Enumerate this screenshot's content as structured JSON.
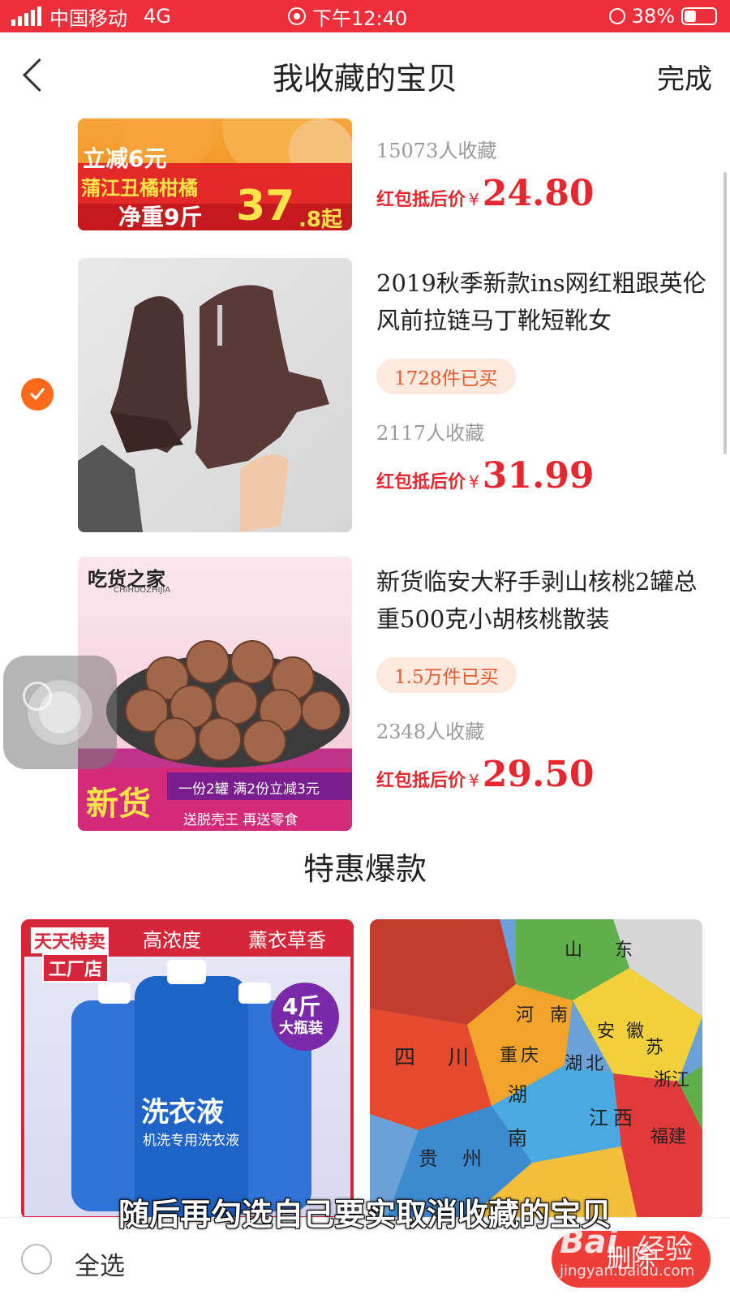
{
  "status_bar": {
    "carrier": "中国移动",
    "network": "4G",
    "time": "下午12:40",
    "battery": "38%",
    "battery_level": 0.38
  },
  "header": {
    "title": "我收藏的宝贝",
    "done": "完成"
  },
  "items": [
    {
      "favorites": "15073人收藏",
      "price_label": "红包抵后价",
      "currency": "¥",
      "price": "24.80",
      "image_text": {
        "line1": "立减6元",
        "line2": "蒲江丑橘柑橘",
        "line3": "净重9斤",
        "big": "37",
        "small": ".8起"
      }
    },
    {
      "name": "2019秋季新款ins网红粗跟英伦风前拉链马丁靴短靴女",
      "sold": "1728件已买",
      "favorites": "2117人收藏",
      "price_label": "红包抵后价",
      "currency": "¥",
      "price": "31.99",
      "checked": true
    },
    {
      "name": "新货临安大籽手剥山核桃2罐总重500克小胡核桃散装",
      "sold": "1.5万件已买",
      "favorites": "2348人收藏",
      "price_label": "红包抵后价",
      "currency": "¥",
      "price": "29.50",
      "image_text": {
        "brand": "吃货之家",
        "brand_en": "CHIHUOZHIJIA",
        "tag": "新货",
        "promo": "一份2罐  满2份立减3元",
        "promo2": "送脱壳王  再送零食"
      }
    }
  ],
  "section_title": "特惠爆款",
  "recommend": [
    {
      "badge_top": "天天特卖",
      "badge_bottom": "工厂店",
      "feat1": "高浓度",
      "feat2": "薰衣草香",
      "bubble1": "4斤",
      "bubble2": "大瓶装",
      "product": "洗衣液",
      "product_sub": "机洗专用洗衣液"
    },
    {
      "labels": [
        "四",
        "川",
        "湖",
        "南",
        "江",
        "西",
        "贵",
        "州",
        "安",
        "徽",
        "浙",
        "江",
        "福",
        "建",
        "山",
        "东",
        "河",
        "南",
        "重",
        "庆",
        "湖",
        "北",
        "苏"
      ]
    }
  ],
  "bottom_bar": {
    "select_all": "全选",
    "delete": "删除"
  },
  "subtitle": "随后再勾选自己要实取消收藏的宝贝",
  "watermark": {
    "logo": "Bai",
    "cn": "经验",
    "url": "jingyan.baidu.com"
  }
}
